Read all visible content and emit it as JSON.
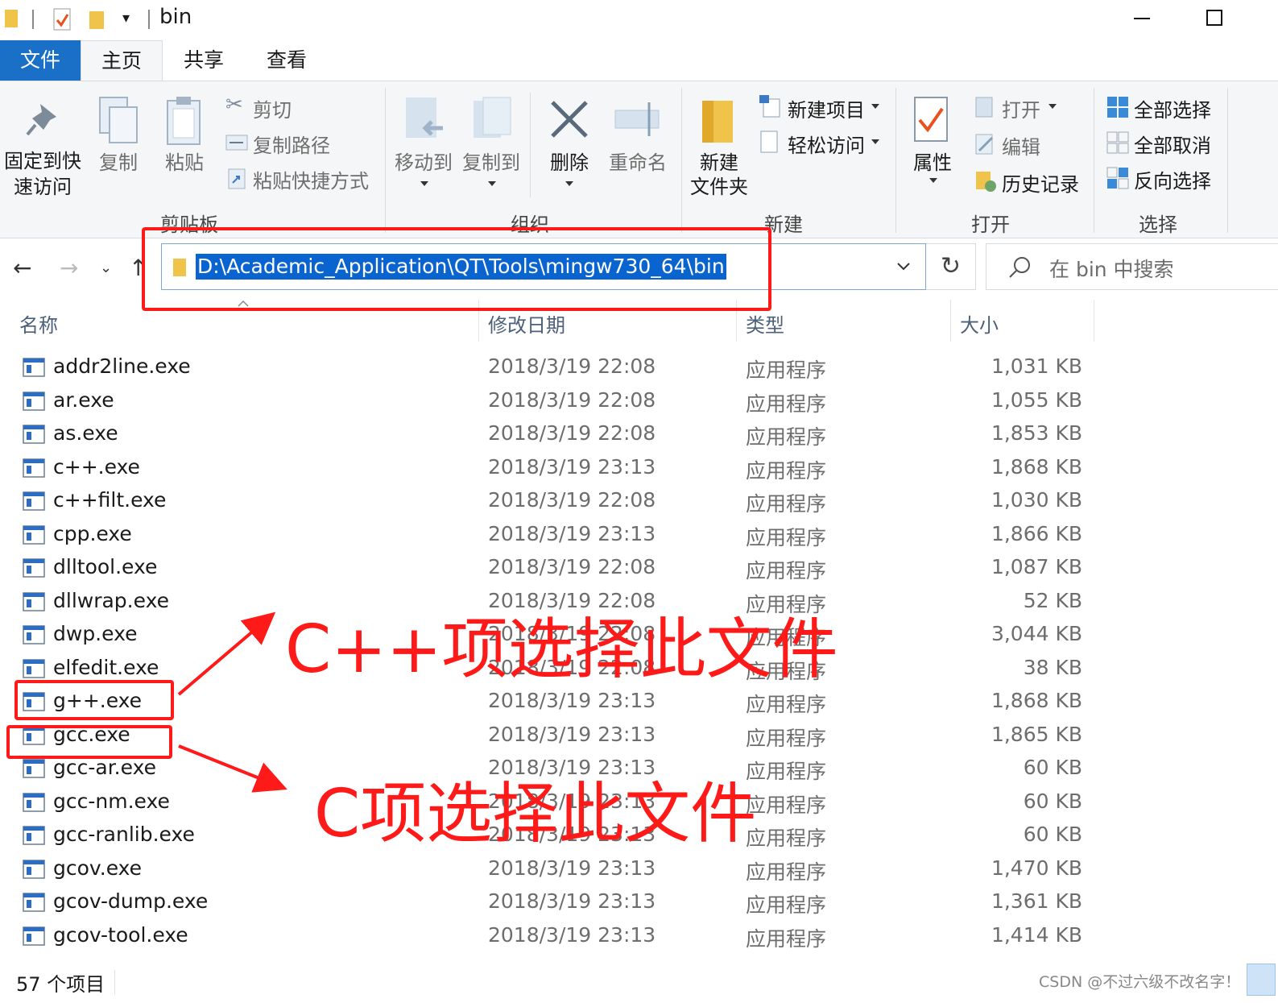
{
  "window": {
    "title": "bin",
    "minimize_glyph": "—",
    "maximize_glyph": "☐"
  },
  "tabs": [
    {
      "label": "文件"
    },
    {
      "label": "主页"
    },
    {
      "label": "共享"
    },
    {
      "label": "查看"
    }
  ],
  "ribbon": {
    "pin": {
      "label_line1": "固定到快",
      "label_line2": "速访问"
    },
    "copy": "复制",
    "paste": "粘贴",
    "cut": "剪切",
    "copy_path": "复制路径",
    "paste_shortcut": "粘贴快捷方式",
    "group_clipboard": "剪贴板",
    "move_to": "移动到",
    "copy_to": "复制到",
    "delete": "删除",
    "rename": "重命名",
    "group_organize": "组织",
    "new_folder_line1": "新建",
    "new_folder_line2": "文件夹",
    "new_item": "新建项目",
    "easy_access": "轻松访问",
    "group_new": "新建",
    "properties": "属性",
    "open": "打开",
    "edit": "编辑",
    "history": "历史记录",
    "group_open": "打开",
    "select_all": "全部选择",
    "select_none": "全部取消",
    "invert_selection": "反向选择",
    "group_select": "选择"
  },
  "address_bar": {
    "path": "D:\\Academic_Application\\QT\\Tools\\mingw730_64\\bin",
    "search_placeholder": "在 bin 中搜索"
  },
  "columns": {
    "name": "名称",
    "date": "修改日期",
    "type": "类型",
    "size": "大小"
  },
  "files": [
    {
      "name": "addr2line.exe",
      "date": "2018/3/19 22:08",
      "type": "应用程序",
      "size": "1,031 KB"
    },
    {
      "name": "ar.exe",
      "date": "2018/3/19 22:08",
      "type": "应用程序",
      "size": "1,055 KB"
    },
    {
      "name": "as.exe",
      "date": "2018/3/19 22:08",
      "type": "应用程序",
      "size": "1,853 KB"
    },
    {
      "name": "c++.exe",
      "date": "2018/3/19 23:13",
      "type": "应用程序",
      "size": "1,868 KB"
    },
    {
      "name": "c++filt.exe",
      "date": "2018/3/19 22:08",
      "type": "应用程序",
      "size": "1,030 KB"
    },
    {
      "name": "cpp.exe",
      "date": "2018/3/19 23:13",
      "type": "应用程序",
      "size": "1,866 KB"
    },
    {
      "name": "dlltool.exe",
      "date": "2018/3/19 22:08",
      "type": "应用程序",
      "size": "1,087 KB"
    },
    {
      "name": "dllwrap.exe",
      "date": "2018/3/19 22:08",
      "type": "应用程序",
      "size": "52 KB"
    },
    {
      "name": "dwp.exe",
      "date": "2018/3/19 22:08",
      "type": "应用程序",
      "size": "3,044 KB"
    },
    {
      "name": "elfedit.exe",
      "date": "2018/3/19 22:08",
      "type": "应用程序",
      "size": "38 KB"
    },
    {
      "name": "g++.exe",
      "date": "2018/3/19 23:13",
      "type": "应用程序",
      "size": "1,868 KB"
    },
    {
      "name": "gcc.exe",
      "date": "2018/3/19 23:13",
      "type": "应用程序",
      "size": "1,865 KB"
    },
    {
      "name": "gcc-ar.exe",
      "date": "2018/3/19 23:13",
      "type": "应用程序",
      "size": "60 KB"
    },
    {
      "name": "gcc-nm.exe",
      "date": "2018/3/19 23:13",
      "type": "应用程序",
      "size": "60 KB"
    },
    {
      "name": "gcc-ranlib.exe",
      "date": "2018/3/19 23:13",
      "type": "应用程序",
      "size": "60 KB"
    },
    {
      "name": "gcov.exe",
      "date": "2018/3/19 23:13",
      "type": "应用程序",
      "size": "1,470 KB"
    },
    {
      "name": "gcov-dump.exe",
      "date": "2018/3/19 23:13",
      "type": "应用程序",
      "size": "1,361 KB"
    },
    {
      "name": "gcov-tool.exe",
      "date": "2018/3/19 23:13",
      "type": "应用程序",
      "size": "1,414 KB"
    }
  ],
  "status": {
    "count": "57 个项目"
  },
  "annotations": {
    "cpp": "C++项选择此文件",
    "c": "C项选择此文件",
    "watermark": "CSDN @不过六级不改名字！"
  },
  "colors": {
    "accent": "#1a6fc6",
    "annotation_red": "#ff1a1a",
    "selection_blue": "#0a64d0"
  }
}
